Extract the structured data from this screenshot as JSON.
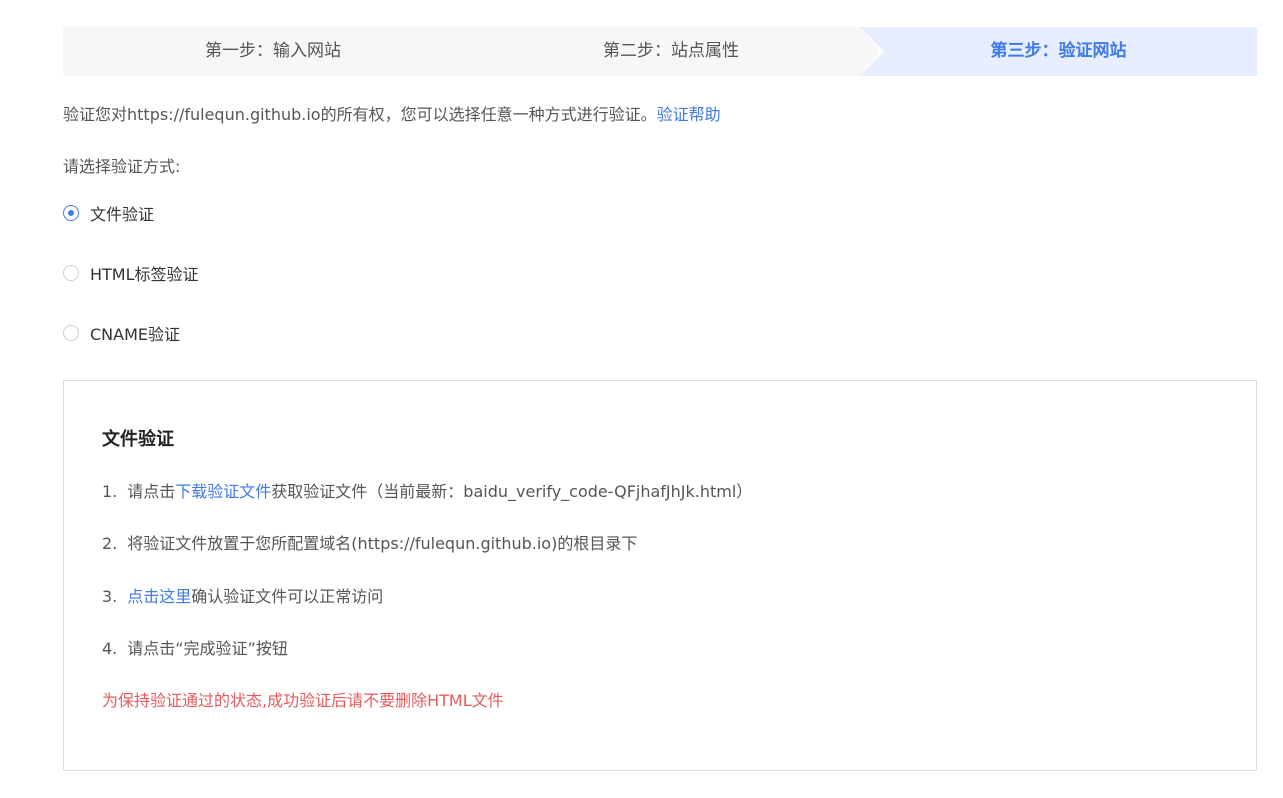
{
  "steps": [
    {
      "label": "第一步：输入网站",
      "active": false
    },
    {
      "label": "第二步：站点属性",
      "active": false
    },
    {
      "label": "第三步：验证网站",
      "active": true
    }
  ],
  "intro": {
    "text": "验证您对https://fulequn.github.io的所有权，您可以选择任意一种方式进行验证。",
    "help_link": "验证帮助"
  },
  "choose_label": "请选择验证方式:",
  "methods": [
    {
      "label": "文件验证",
      "selected": true
    },
    {
      "label": "HTML标签验证",
      "selected": false
    },
    {
      "label": "CNAME验证",
      "selected": false
    }
  ],
  "panel": {
    "title": "文件验证",
    "items": [
      {
        "num": "1.",
        "prefix": "请点击",
        "link": "下载验证文件",
        "suffix": "获取验证文件（当前最新：baidu_verify_code-QFjhafJhJk.html）"
      },
      {
        "num": "2.",
        "prefix": "将验证文件放置于您所配置域名(https://fulequn.github.io)的根目录下",
        "link": "",
        "suffix": ""
      },
      {
        "num": "3.",
        "prefix": "",
        "link": "点击这里",
        "suffix": "确认验证文件可以正常访问"
      },
      {
        "num": "4.",
        "prefix": "请点击“完成验证”按钮",
        "link": "",
        "suffix": ""
      }
    ],
    "warning": "为保持验证通过的状态,成功验证后请不要删除HTML文件"
  },
  "colors": {
    "accent": "#3f7ae6",
    "warning": "#e55b5b",
    "step_active_bg": "#e6eeff",
    "step_bg": "#f7f7f7"
  }
}
